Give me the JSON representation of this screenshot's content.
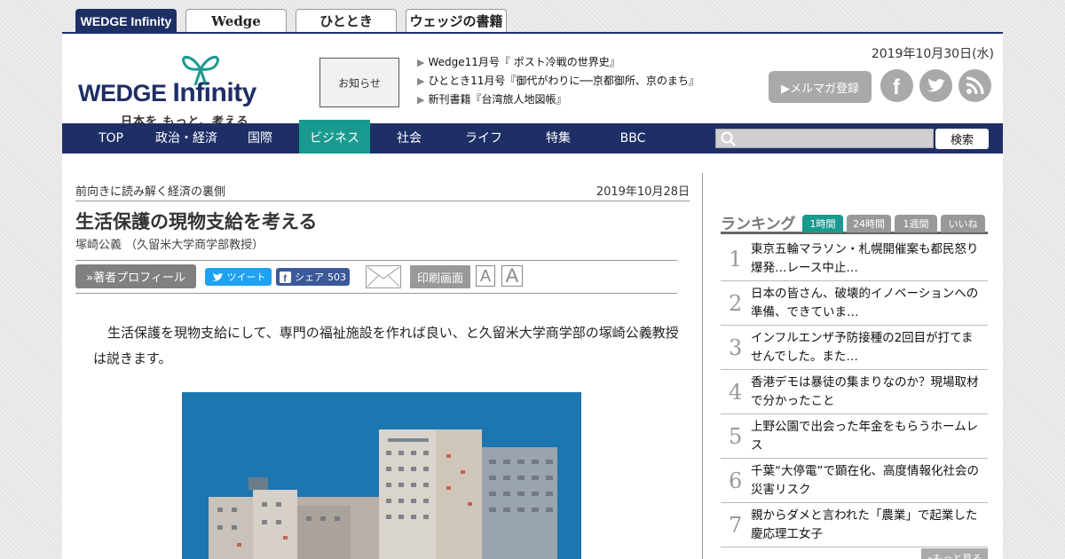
{
  "site_tabs": [
    {
      "label": "WEDGE Infinity"
    },
    {
      "label": "Wedge"
    },
    {
      "label": "ひととき"
    },
    {
      "label": "ウェッジの書籍"
    }
  ],
  "header": {
    "logo_text": "WEDGE",
    "logo_text_2": "Infinity",
    "logo_tagline": "日本を もっと、考える",
    "notice_label": "お知らせ",
    "news": [
      "Wedge11月号『 ポスト冷戦の世界史』",
      "ひととき11月号『御代がわりに──京都御所、京のまち』",
      "新刊書籍『台湾旅人地図帳』"
    ],
    "date": "2019年10月30日(水)",
    "mailmag_label": "▶メルマガ登録"
  },
  "nav": {
    "items": [
      "TOP",
      "政治・経済",
      "国際",
      "ビジネス",
      "社会",
      "ライフ",
      "特集",
      "BBC"
    ],
    "active": "ビジネス",
    "search_label": "検索"
  },
  "article": {
    "series": "前向きに読み解く経済の裏側",
    "date": "2019年10月28日",
    "title": "生活保護の現物支給を考える",
    "author": "塚崎公義 （久留米大学商学部教授）",
    "profile_button": "»著者プロフィール",
    "tweet_label": "ツイート",
    "share_label": "シェア",
    "share_count": "503",
    "print_label": "印刷画面",
    "font_small": "A",
    "font_large": "A",
    "body": "生活保護を現物支給にして、専門の福祉施設を作れば良い、と久留米大学商学部の塚崎公義教授は説きます。"
  },
  "ranking": {
    "title": "ランキング",
    "tabs": [
      "1時間",
      "24時間",
      "1週間",
      "いいね"
    ],
    "active_tab": "1時間",
    "items": [
      {
        "rank": "1",
        "text": "東京五輪マラソン・札幌開催案も都民怒り爆発…レース中止…"
      },
      {
        "rank": "2",
        "text": "日本の皆さん、破壊的イノベーションへの準備、できていま…"
      },
      {
        "rank": "3",
        "text": "インフルエンザ予防接種の2回目が打てませんでした。また…"
      },
      {
        "rank": "4",
        "text": "香港デモは暴徒の集まりなのか？現場取材で分かったこと"
      },
      {
        "rank": "5",
        "text": "上野公園で出会った年金をもらうホームレス"
      },
      {
        "rank": "6",
        "text": "千葉“大停電”で顕在化、高度情報化社会の災害リスク"
      },
      {
        "rank": "7",
        "text": "親からダメと言われた「農業」で起業した慶応理工女子"
      }
    ],
    "more_label": "»もっと見る"
  },
  "colors": {
    "navy": "#1e2f66",
    "teal": "#1a9a8f",
    "twitter": "#1da1f2",
    "facebook": "#3b5998"
  }
}
